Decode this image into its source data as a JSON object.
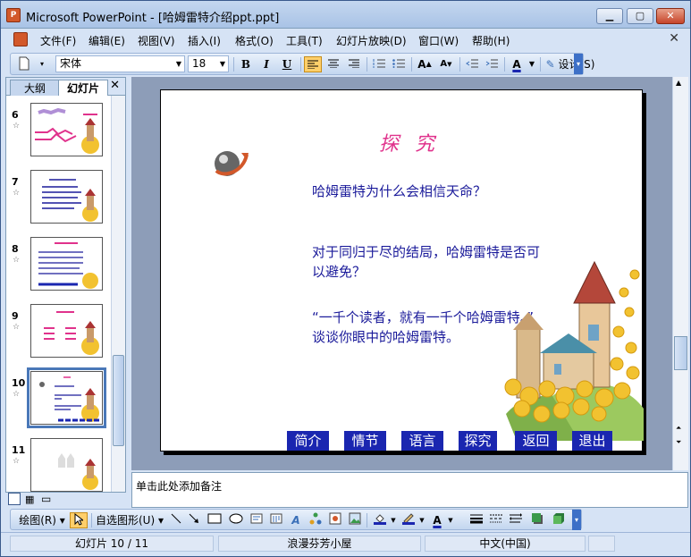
{
  "window": {
    "app_icon": "powerpoint-icon",
    "title": "Microsoft PowerPoint - [哈姆雷特介绍ppt.ppt]",
    "minimize": "▁",
    "maximize": "▢",
    "close": "✕"
  },
  "menu": {
    "items": [
      "文件(F)",
      "编辑(E)",
      "视图(V)",
      "插入(I)",
      "格式(O)",
      "工具(T)",
      "幻灯片放映(D)",
      "窗口(W)",
      "帮助(H)"
    ],
    "close": "✕"
  },
  "toolbar": {
    "font_name": "宋体",
    "font_size": "18",
    "bold": "B",
    "italic": "I",
    "underline": "U",
    "design_label": "设计(S)"
  },
  "left_pane": {
    "tabs": [
      "大纲",
      "幻灯片"
    ],
    "close": "✕",
    "slides": [
      {
        "number": "6",
        "star": "☆"
      },
      {
        "number": "7",
        "star": "☆"
      },
      {
        "number": "8",
        "star": "☆"
      },
      {
        "number": "9",
        "star": "☆"
      },
      {
        "number": "10",
        "star": "☆",
        "selected": true
      },
      {
        "number": "11",
        "star": "☆"
      }
    ]
  },
  "slide": {
    "title": "探究",
    "question1": "哈姆雷特为什么会相信天命？",
    "question2_line1": "对于同归于尽的结局，哈姆雷特是否可",
    "question2_line2": "以避免？",
    "question3_line1": "“一千个读者，就有一千个哈姆雷特。”",
    "question3_line2": "谈谈你眼中的哈姆雷特。",
    "nav_buttons": [
      "简介",
      "情节",
      "语言",
      "探究",
      "返回",
      "退出"
    ],
    "colors": {
      "title": "#e0328c",
      "text": "#1a1a9a",
      "nav": "#1a26b0"
    }
  },
  "notes": {
    "placeholder": "单击此处添加备注"
  },
  "draw_toolbar": {
    "draw_label": "绘图(R)",
    "autoshape_label": "自选图形(U)"
  },
  "statusbar": {
    "slide_position": "幻灯片 10 / 11",
    "design_template": "浪漫芬芳小屋",
    "language": "中文(中国)"
  }
}
